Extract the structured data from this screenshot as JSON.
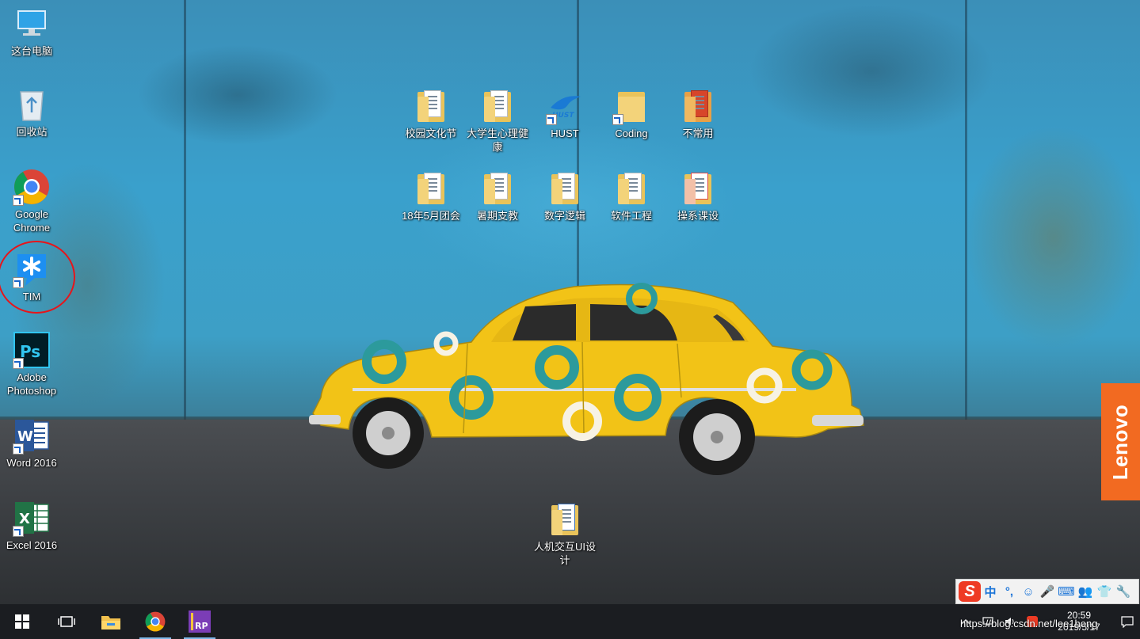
{
  "desktop": {
    "left_icons": [
      {
        "label": "这台电脑",
        "icon": "this-pc-icon"
      },
      {
        "label": "回收站",
        "icon": "recycle-bin-icon"
      },
      {
        "label": "Google Chrome",
        "icon": "chrome-icon"
      },
      {
        "label": "TIM",
        "icon": "tim-icon"
      },
      {
        "label": "Adobe Photoshop",
        "icon": "photoshop-icon"
      },
      {
        "label": "Word 2016",
        "icon": "word-icon"
      },
      {
        "label": "Excel 2016",
        "icon": "excel-icon"
      }
    ],
    "folders_row1": [
      {
        "label": "校园文化节"
      },
      {
        "label": "大学生心理健康"
      },
      {
        "label": "HUST"
      },
      {
        "label": "Coding"
      },
      {
        "label": "不常用"
      }
    ],
    "folders_row2": [
      {
        "label": "18年5月团会"
      },
      {
        "label": "暑期支教"
      },
      {
        "label": "数字逻辑"
      },
      {
        "label": "软件工程"
      },
      {
        "label": "操系课设"
      }
    ],
    "bottom_folder": {
      "label": "人机交互UI设计"
    },
    "brand": "Lenovo"
  },
  "ime": {
    "logo": "S",
    "items": [
      "中",
      "°,",
      "☺",
      "🎤",
      "⌨",
      "👥",
      "👕",
      "🔧"
    ]
  },
  "taskbar": {
    "clock_time": "20:59",
    "clock_date": "2019/5/17",
    "watermark": "https://blog.csdn.net/lee1hong"
  },
  "colors": {
    "taskbar_bg": "#1b1d21",
    "lenovo_orange": "#f26a21",
    "highlight_circle": "#e8141a",
    "ime_red": "#ee3b24"
  }
}
